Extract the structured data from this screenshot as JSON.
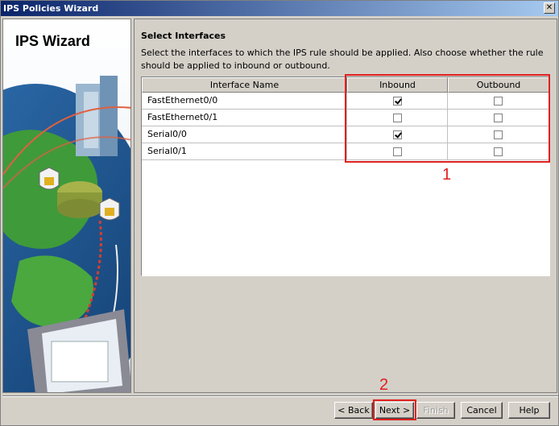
{
  "window": {
    "title": "IPS Policies Wizard",
    "close_glyph": "✕"
  },
  "sidebar": {
    "title": "IPS Wizard"
  },
  "section": {
    "title": "Select Interfaces",
    "description": "Select the interfaces to which the IPS rule should be applied. Also choose whether the rule should be applied to inbound or outbound."
  },
  "table": {
    "columns": [
      "Interface Name",
      "Inbound",
      "Outbound"
    ],
    "rows": [
      {
        "name": "FastEthernet0/0",
        "inbound": true,
        "outbound": false
      },
      {
        "name": "FastEthernet0/1",
        "inbound": false,
        "outbound": false
      },
      {
        "name": "Serial0/0",
        "inbound": true,
        "outbound": false
      },
      {
        "name": "Serial0/1",
        "inbound": false,
        "outbound": false
      }
    ]
  },
  "annotations": {
    "marker1": "1",
    "marker2": "2",
    "color": "#e02020"
  },
  "buttons": {
    "back": "< Back",
    "next": "Next >",
    "finish": "Finish",
    "cancel": "Cancel",
    "help": "Help"
  }
}
